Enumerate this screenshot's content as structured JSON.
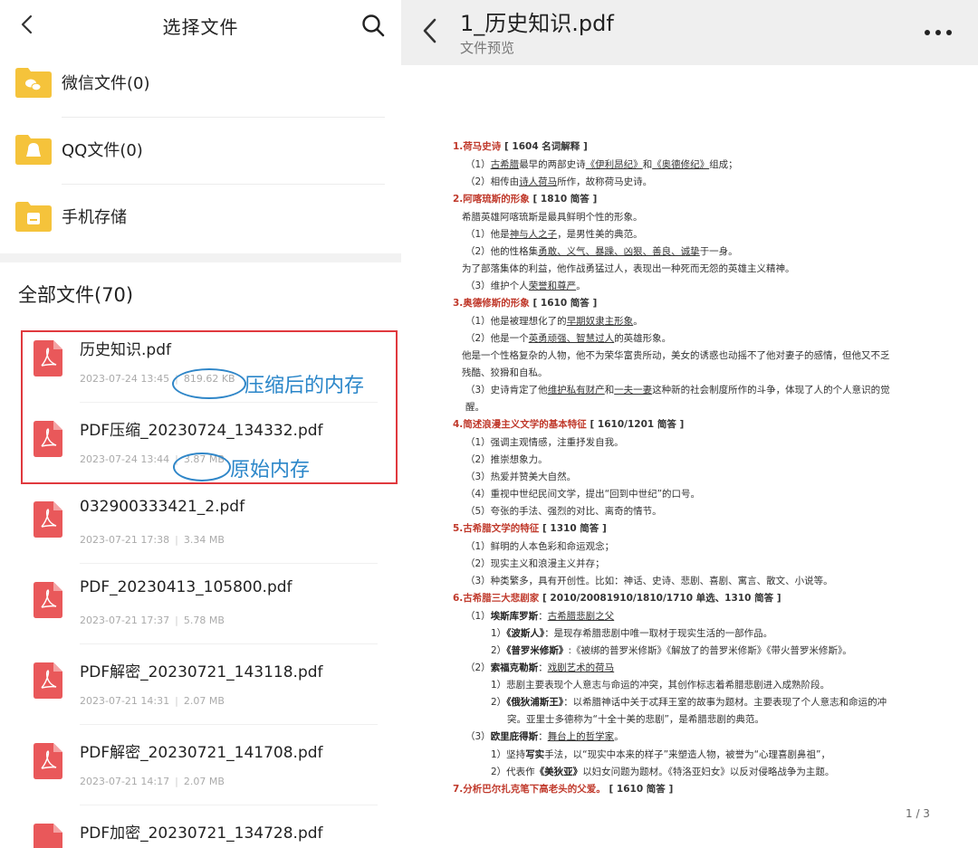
{
  "left": {
    "title": "选择文件",
    "sources": [
      {
        "label": "微信文件(0)",
        "color": "#f5c33b"
      },
      {
        "label": "QQ文件(0)",
        "color": "#f5c33b"
      },
      {
        "label": "手机存储",
        "color": "#f5c33b"
      }
    ],
    "all_files_label": "全部文件(70)",
    "files": [
      {
        "name": "历史知识.pdf",
        "date": "2023-07-24 13:45",
        "size": "819.62 KB"
      },
      {
        "name": "PDF压缩_20230724_134332.pdf",
        "date": "2023-07-24 13:44",
        "size": "3.87 MB"
      },
      {
        "name": "032900333421_2.pdf",
        "date": "2023-07-21 17:38",
        "size": "3.34 MB"
      },
      {
        "name": "PDF_20230413_105800.pdf",
        "date": "2023-07-21 17:37",
        "size": "5.78 MB"
      },
      {
        "name": "PDF解密_20230721_143118.pdf",
        "date": "2023-07-21 14:31",
        "size": "2.07 MB"
      },
      {
        "name": "PDF解密_20230721_141708.pdf",
        "date": "2023-07-21 14:17",
        "size": "2.07 MB"
      },
      {
        "name": "PDF加密_20230721_134728.pdf",
        "date": "",
        "size": ""
      }
    ],
    "annotations": {
      "compressed": "压缩后的内存",
      "original": "原始内存"
    }
  },
  "right": {
    "title": "1_历史知识.pdf",
    "subtitle": "文件预览",
    "page_indicator": "1 / 3"
  },
  "colors": {
    "accent_red": "#e0393e",
    "annotation_blue": "#2a86c9",
    "folder_yellow": "#f5c33b",
    "pdf_red": "#e9585a"
  }
}
